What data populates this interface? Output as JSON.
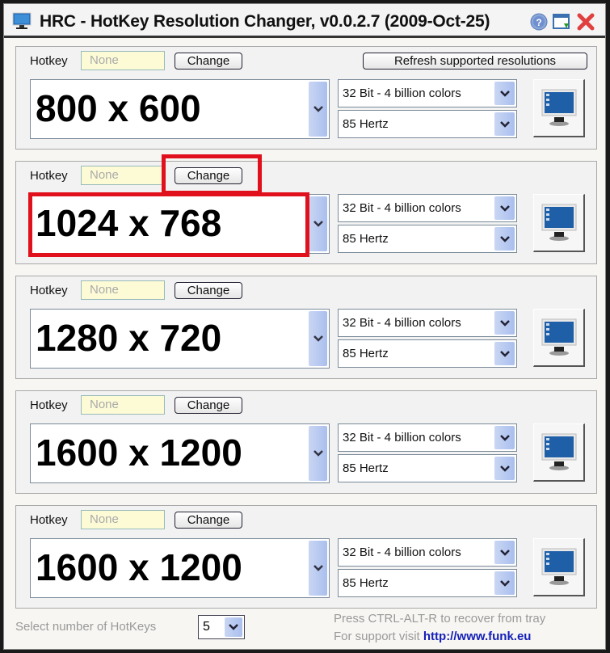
{
  "window": {
    "title": "HRC - HotKey Resolution Changer, v0.0.2.7 (2009-Oct-25)",
    "buttons": [
      {
        "name": "help",
        "icon": "help-icon"
      },
      {
        "name": "minimize-to-tray",
        "icon": "tray-icon"
      },
      {
        "name": "close",
        "icon": "close-icon"
      }
    ]
  },
  "refresh_button": "Refresh supported resolutions",
  "profiles": [
    {
      "hotkey_label": "Hotkey",
      "hotkey_value": "None",
      "change_label": "Change",
      "resolution": "800 x 600",
      "color_depth": "32 Bit - 4 billion colors",
      "refresh_rate": "85 Hertz"
    },
    {
      "hotkey_label": "Hotkey",
      "hotkey_value": "None",
      "change_label": "Change",
      "resolution": "1024 x 768",
      "color_depth": "32 Bit - 4 billion colors",
      "refresh_rate": "85 Hertz"
    },
    {
      "hotkey_label": "Hotkey",
      "hotkey_value": "None",
      "change_label": "Change",
      "resolution": "1280 x 720",
      "color_depth": "32 Bit - 4 billion colors",
      "refresh_rate": "85 Hertz"
    },
    {
      "hotkey_label": "Hotkey",
      "hotkey_value": "None",
      "change_label": "Change",
      "resolution": "1600 x 1200",
      "color_depth": "32 Bit - 4 billion colors",
      "refresh_rate": "85 Hertz"
    },
    {
      "hotkey_label": "Hotkey",
      "hotkey_value": "None",
      "change_label": "Change",
      "resolution": "1600 x 1200",
      "color_depth": "32 Bit - 4 billion colors",
      "refresh_rate": "85 Hertz"
    }
  ],
  "footer": {
    "count_label": "Select number of HotKeys",
    "count_value": "5",
    "hint_recover": "Press CTRL-ALT-R to recover from tray",
    "support_prefix": "For support visit",
    "support_link": "http://www.funk.eu"
  },
  "colors": {
    "highlight": "#e0101c",
    "link": "#1420b8",
    "hotkey_field_bg": "#fdfbd6"
  }
}
